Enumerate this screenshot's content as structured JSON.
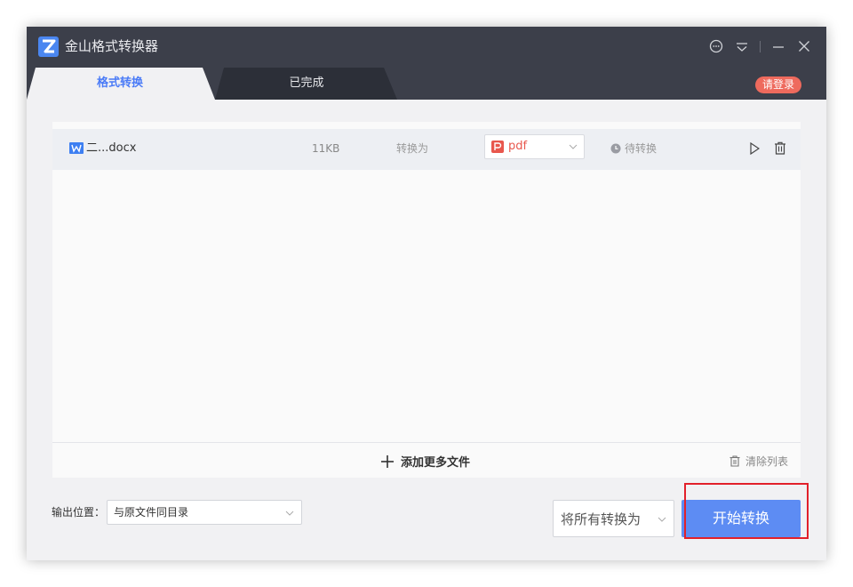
{
  "window": {
    "title": "金山格式转换器",
    "icons": [
      "feedback-icon",
      "menu-icon",
      "minimize-icon",
      "close-icon"
    ],
    "login_label": "请登录"
  },
  "tabs": [
    {
      "label": "格式转换",
      "active": true
    },
    {
      "label": "已完成",
      "active": false
    }
  ],
  "file_list": {
    "items": [
      {
        "name": "二...docx",
        "size": "11KB",
        "convert_label": "转换为",
        "target_format": "pdf",
        "status": "待转换"
      }
    ]
  },
  "footer": {
    "add_more_label": "添加更多文件",
    "clear_list_label": "清除列表"
  },
  "bottom": {
    "output_label": "输出位置：",
    "output_value": "与原文件同目录",
    "convert_all_label": "将所有转换为",
    "start_label": "开始转换"
  },
  "colors": {
    "titlebar": "#3c3f4a",
    "accent": "#4a7bf7",
    "start_button": "#5d8cf3",
    "pdf_red": "#e8574d",
    "login_badge": "#ee6a5d",
    "highlight_box": "#e2202a"
  }
}
